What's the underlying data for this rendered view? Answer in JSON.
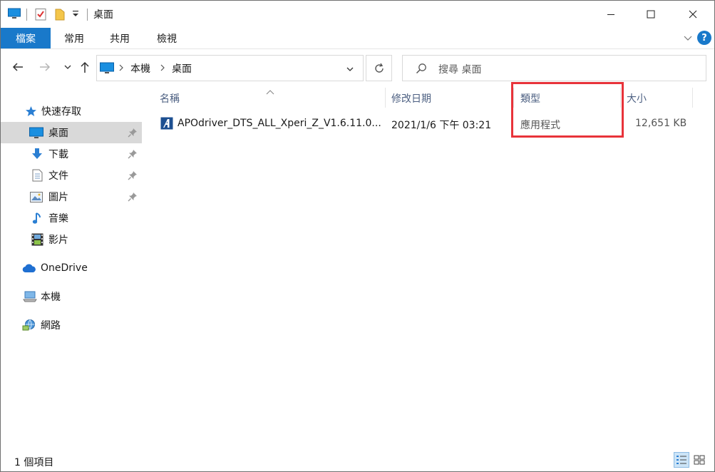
{
  "window": {
    "title": "桌面"
  },
  "ribbon": {
    "tabs": [
      "檔案",
      "常用",
      "共用",
      "檢視"
    ],
    "help": "?"
  },
  "address": {
    "path": [
      "本機",
      "桌面"
    ]
  },
  "search": {
    "placeholder": "搜尋 桌面"
  },
  "sidebar": {
    "items": [
      {
        "label": "快速存取",
        "icon": "star-icon",
        "pinned": false
      },
      {
        "label": "桌面",
        "icon": "desktop-icon",
        "pinned": true,
        "selected": true
      },
      {
        "label": "下載",
        "icon": "download-arrow-icon",
        "pinned": true
      },
      {
        "label": "文件",
        "icon": "document-icon",
        "pinned": true
      },
      {
        "label": "圖片",
        "icon": "picture-icon",
        "pinned": true
      },
      {
        "label": "音樂",
        "icon": "music-note-icon",
        "pinned": false
      },
      {
        "label": "影片",
        "icon": "film-icon",
        "pinned": false
      },
      {
        "label": "OneDrive",
        "icon": "cloud-icon",
        "pinned": false
      },
      {
        "label": "本機",
        "icon": "computer-icon",
        "pinned": false
      },
      {
        "label": "網路",
        "icon": "network-icon",
        "pinned": false
      }
    ]
  },
  "columns": [
    "名稱",
    "修改日期",
    "類型",
    "大小"
  ],
  "files": [
    {
      "name": "APOdriver_DTS_ALL_Xperi_Z_V1.6.11.0...",
      "modified": "2021/1/6 下午 03:21",
      "type": "應用程式",
      "size": "12,651 KB"
    }
  ],
  "status": {
    "count": "1 個項目"
  },
  "colors": {
    "accent": "#1979ca",
    "highlight_box": "#e8333a",
    "selected_bg": "#d9d9d9"
  }
}
